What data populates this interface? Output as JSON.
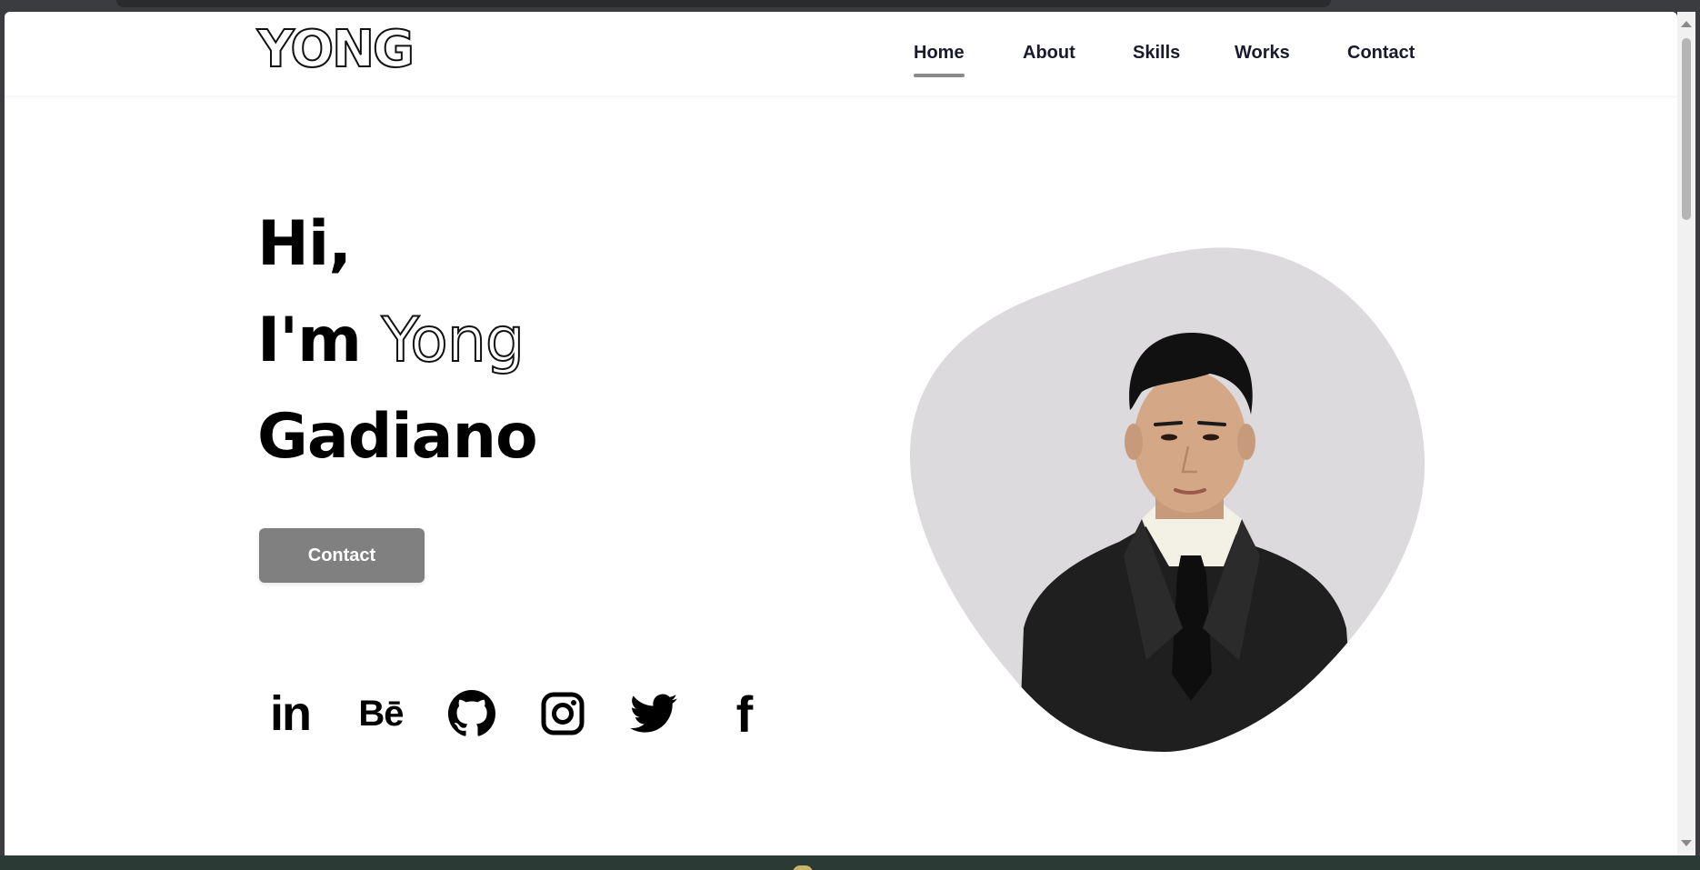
{
  "header": {
    "logo": "YONG",
    "nav": [
      {
        "label": "Home",
        "active": true
      },
      {
        "label": "About",
        "active": false
      },
      {
        "label": "Skills",
        "active": false
      },
      {
        "label": "Works",
        "active": false
      },
      {
        "label": "Contact",
        "active": false
      }
    ]
  },
  "hero": {
    "greeting": "Hi,",
    "intro": "I'm",
    "first_name": "Yong",
    "last_name": "Gadiano",
    "contact_button": "Contact"
  },
  "social": {
    "linkedin_label": "in",
    "behance_label": "Bē",
    "facebook_label": "f",
    "icons": [
      "linkedin-icon",
      "behance-icon",
      "github-icon",
      "instagram-icon",
      "twitter-icon",
      "facebook-icon"
    ]
  },
  "colors": {
    "accent": "#808080",
    "blob": "#dcdadc",
    "text": "#000000",
    "nav_text": "#1a1a2e"
  }
}
